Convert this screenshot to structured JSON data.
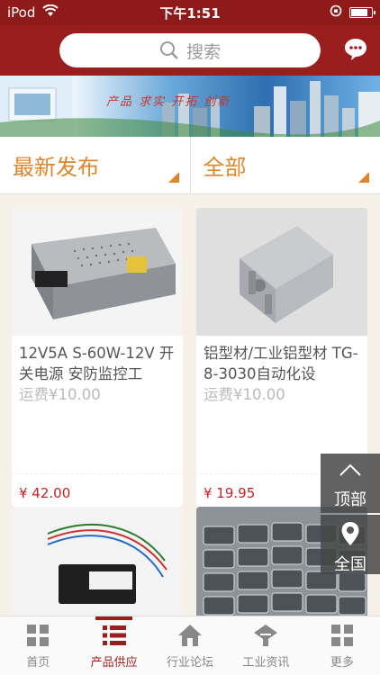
{
  "status_bar": {
    "carrier": "iPod",
    "time": "下午1:51"
  },
  "header": {
    "search_placeholder": "搜索"
  },
  "banner": {
    "slogan": "产品 求实 开拓 创新"
  },
  "filters": [
    {
      "label": "最新发布"
    },
    {
      "label": "全部"
    }
  ],
  "products": [
    {
      "title": "12V5A S-60W-12V 开关电源 安防监控工",
      "freight": "运费¥10.00",
      "price": "¥ 42.00",
      "icon": "power-supply-image"
    },
    {
      "title": "铝型材/工业铝型材 TG-8-3030自动化设",
      "freight": "运费¥10.00",
      "price": "¥ 19.95",
      "icon": "aluminum-profile-image"
    },
    {
      "title": "",
      "freight": "",
      "price": "",
      "icon": "driver-module-image"
    },
    {
      "title": "",
      "freight": "",
      "price": "",
      "icon": "packaged-parts-image"
    }
  ],
  "floating": {
    "top_label": "顶部",
    "region_label": "全国"
  },
  "tabbar": [
    {
      "label": "首页",
      "icon": "grid-icon"
    },
    {
      "label": "产品供应",
      "icon": "list-icon"
    },
    {
      "label": "行业论坛",
      "icon": "home-icon"
    },
    {
      "label": "工业资讯",
      "icon": "news-icon"
    },
    {
      "label": "更多",
      "icon": "more-icon"
    }
  ],
  "colors": {
    "brand": "#9a1e1e",
    "accent": "#e0862a",
    "price": "#c52323"
  }
}
